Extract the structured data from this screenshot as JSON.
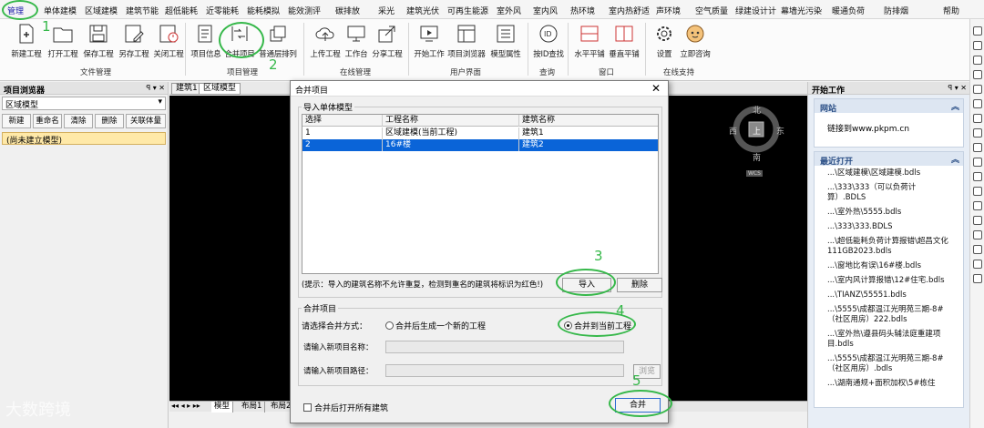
{
  "menubar": {
    "items": [
      "管理",
      "单体建模",
      "区域建模",
      "建筑节能",
      "超低能耗",
      "近零能耗",
      "能耗模拟",
      "能效测评",
      "碳排放",
      "采光",
      "建筑光伏",
      "可再生能源",
      "室外风",
      "室内风",
      "热环境",
      "室内热舒适",
      "声环境",
      "空气质量",
      "绿建设计计",
      "幕墙光污染",
      "暖通负荷",
      "防排烟",
      "帮助"
    ]
  },
  "ribbon": {
    "file": {
      "group": "文件管理",
      "buttons": [
        "新建工程",
        "打开工程",
        "保存工程",
        "另存工程",
        "关闭工程"
      ]
    },
    "project": {
      "group": "项目管理",
      "buttons": [
        "项目信息",
        "合并项目",
        "普通层排列"
      ]
    },
    "online": {
      "group": "在线管理",
      "buttons": [
        "上传工程",
        "工作台",
        "分享工程"
      ]
    },
    "ui": {
      "group": "用户界面",
      "buttons": [
        "开始工作",
        "项目浏览器",
        "模型属性"
      ]
    },
    "query": {
      "group": "查询",
      "buttons": [
        "按ID查找"
      ]
    },
    "window": {
      "group": "窗口",
      "buttons": [
        "水平平铺",
        "垂直平铺"
      ]
    },
    "support": {
      "group": "在线支持",
      "buttons": [
        "设置",
        "立即咨询"
      ]
    }
  },
  "left_panel": {
    "title": "项目浏览器",
    "controls": "ꟼ ▾ ✕",
    "select_value": "区域模型",
    "buttons": [
      "新建",
      "重命名",
      "清除",
      "删除",
      "关联体量"
    ],
    "tree_item": "(尚未建立模型)"
  },
  "doc_tabs": [
    "建筑1",
    "区域模型"
  ],
  "bottom_tabs": [
    "模型",
    "布局1",
    "布局2"
  ],
  "compass": {
    "n": "北",
    "s": "南",
    "w": "西",
    "e": "东",
    "top": "上",
    "badge": "WCS"
  },
  "right_panel": {
    "title": "开始工作",
    "controls": "ꟼ ▾ ✕",
    "website": {
      "title": "网站",
      "link": "链接到www.pkpm.cn"
    },
    "recent": {
      "title": "最近打开",
      "items": [
        "...\\区域建模\\区域建模.bdls",
        "...\\333\\333（可以负荷计算）.BDLS",
        "...\\室外热\\5555.bdls",
        "...\\333\\333.BDLS",
        "...\\超低能耗负荷计算报错\\超昌文化111GB2023.bdls",
        "...\\窗地比有误\\16#楼.bdls",
        "...\\室内风计算报错\\12#住宅.bdls",
        "...\\TIANZ\\55551.bdls",
        "...\\5555\\成都温江光明苑三期-8#（社区用房）222.bdls",
        "...\\室外热\\遵县码头辅法庭重建项目.bdls",
        "...\\5555\\成都温江光明苑三期-8#（社区用房）.bdls",
        "...\\湖南通规+面积加权\\5#栋住"
      ]
    }
  },
  "dialog": {
    "title": "合并项目",
    "close": "✕",
    "import_section": "导入单体模型",
    "columns": [
      "选择",
      "工程名称",
      "建筑名称"
    ],
    "rows": [
      {
        "sel": "1",
        "project": "区域建模(当前工程)",
        "building": "建筑1"
      },
      {
        "sel": "2",
        "project": "16#楼",
        "building": "建筑2"
      }
    ],
    "hint": "(提示：导入的建筑名称不允许重复，检测到重名的建筑将标识为红色!)",
    "import_btn": "导入",
    "delete_btn": "删除",
    "merge_section": "合并项目",
    "merge_mode_label": "请选择合并方式：",
    "option_new": "合并后生成一个新的工程",
    "option_current": "合并到当前工程",
    "name_label": "请输入新项目名称：",
    "path_label": "请输入新项目路径：",
    "browse_btn": "浏览",
    "open_all": "合并后打开所有建筑",
    "merge_btn": "合并"
  },
  "annotations": [
    "1",
    "2",
    "3",
    "4",
    "5"
  ],
  "watermark": "大数跨境",
  "colors": {
    "annotation": "#36b84a",
    "selection": "#0a64d8",
    "menu_active": "#1a1aa8"
  }
}
